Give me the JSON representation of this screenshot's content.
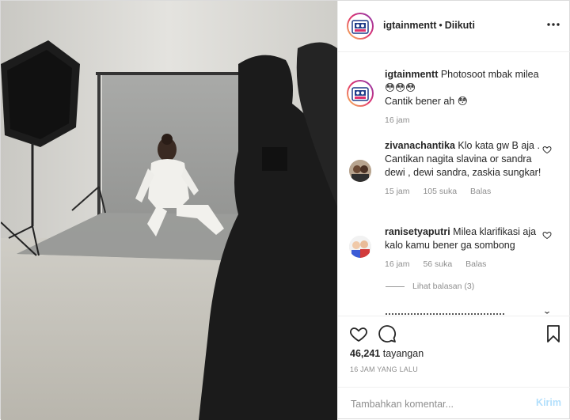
{
  "header": {
    "username": "igtainmentt",
    "separator": "•",
    "follow_status": "Diikuti",
    "more_icon": "more-horizontal-icon"
  },
  "caption": {
    "username": "igtainmentt",
    "text_line1": "Photosoot mbak milea",
    "text_line2": "😳😳😳",
    "text_line3": "Cantik bener ah 😳",
    "time": "16 jam"
  },
  "comments": [
    {
      "username": "zivanachantika",
      "text": "Klo kata gw B aja . Cantikan nagita slavina or sandra dewi , dewi sandra, zaskia sungkar!",
      "time": "15 jam",
      "likes": "105 suka",
      "reply_label": "Balas"
    },
    {
      "username": "ranisetyaputri",
      "text": "Milea klarifikasi aja kalo kamu bener ga sombong",
      "time": "16 jam",
      "likes": "56 suka",
      "reply_label": "Balas"
    }
  ],
  "view_replies": "Lihat balasan (3)",
  "actions": {
    "like_icon": "heart-icon",
    "comment_icon": "comment-icon",
    "save_icon": "bookmark-icon"
  },
  "views_count": "46,241",
  "views_label": "tayangan",
  "time_ago": "16 JAM YANG LALU",
  "add_comment": {
    "placeholder": "Tambahkan komentar...",
    "post_label": "Kirim"
  },
  "colors": {
    "link_disabled": "#b2dffc",
    "muted": "#8e8e8e",
    "text": "#262626"
  }
}
